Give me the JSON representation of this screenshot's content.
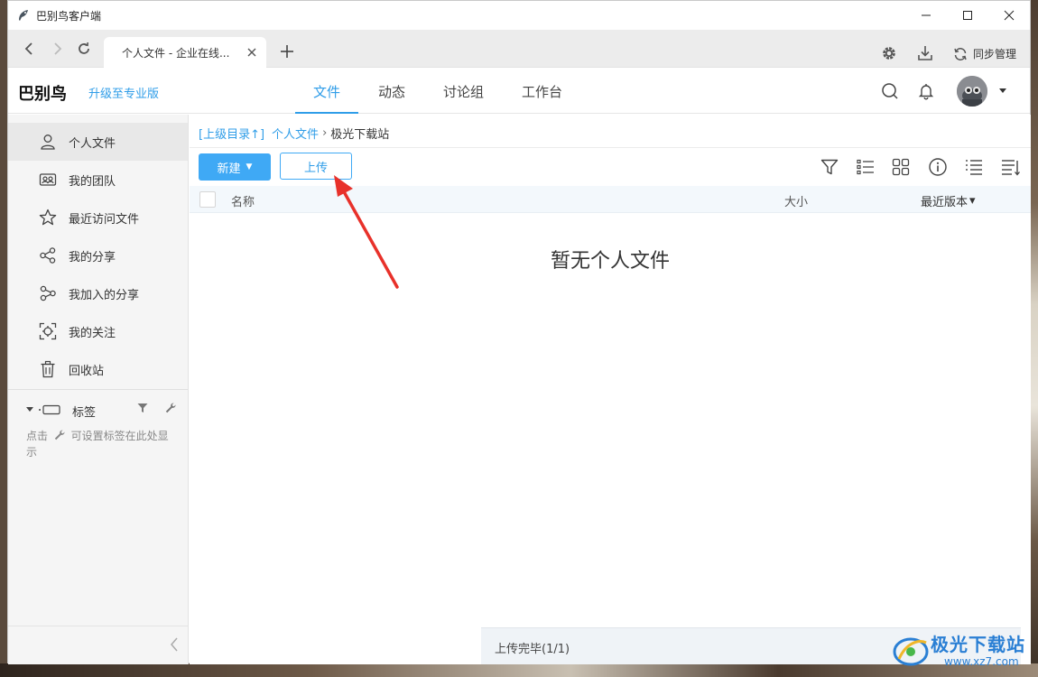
{
  "window": {
    "title": "巴别鸟客户端"
  },
  "browser": {
    "tab_label": "个人文件 - 企业在线...",
    "sync_label": "同步管理"
  },
  "header": {
    "brand": "巴别鸟",
    "upgrade": "升级至专业版",
    "tabs": [
      {
        "label": "文件",
        "active": true
      },
      {
        "label": "动态",
        "active": false
      },
      {
        "label": "讨论组",
        "active": false
      },
      {
        "label": "工作台",
        "active": false
      }
    ]
  },
  "sidebar": {
    "items": [
      {
        "label": "个人文件",
        "icon": "user-icon",
        "active": true
      },
      {
        "label": "我的团队",
        "icon": "team-icon",
        "active": false
      },
      {
        "label": "最近访问文件",
        "icon": "star-icon",
        "active": false
      },
      {
        "label": "我的分享",
        "icon": "share-icon",
        "active": false
      },
      {
        "label": "我加入的分享",
        "icon": "joined-share-icon",
        "active": false
      },
      {
        "label": "我的关注",
        "icon": "focus-icon",
        "active": false
      },
      {
        "label": "回收站",
        "icon": "trash-icon",
        "active": false
      }
    ],
    "tags_label": "标签",
    "tags_hint_before": "点击",
    "tags_hint_after": "可设置标签在此处显示"
  },
  "breadcrumb": {
    "parent_link": "[上级目录↑]",
    "root": "个人文件",
    "separator": "›",
    "current": "极光下载站"
  },
  "toolbar": {
    "new_label": "新建",
    "new_caret": "▼",
    "upload_label": "上传",
    "view_icons": [
      "filter-icon",
      "list-view-icon",
      "grid-view-icon",
      "info-icon",
      "sort-icon",
      "detail-list-icon"
    ]
  },
  "table": {
    "col_name": "名称",
    "col_size": "大小",
    "col_version": "最近版本",
    "col_version_caret": "▾"
  },
  "empty_message": "暂无个人文件",
  "upload_status": "上传完毕(1/1)",
  "watermark": {
    "text": "极光下载站",
    "url": "www.xz7.com"
  },
  "colors": {
    "accent": "#2f9de8",
    "button_blue": "#3fa9f5",
    "annotation_arrow": "#e8312a"
  }
}
